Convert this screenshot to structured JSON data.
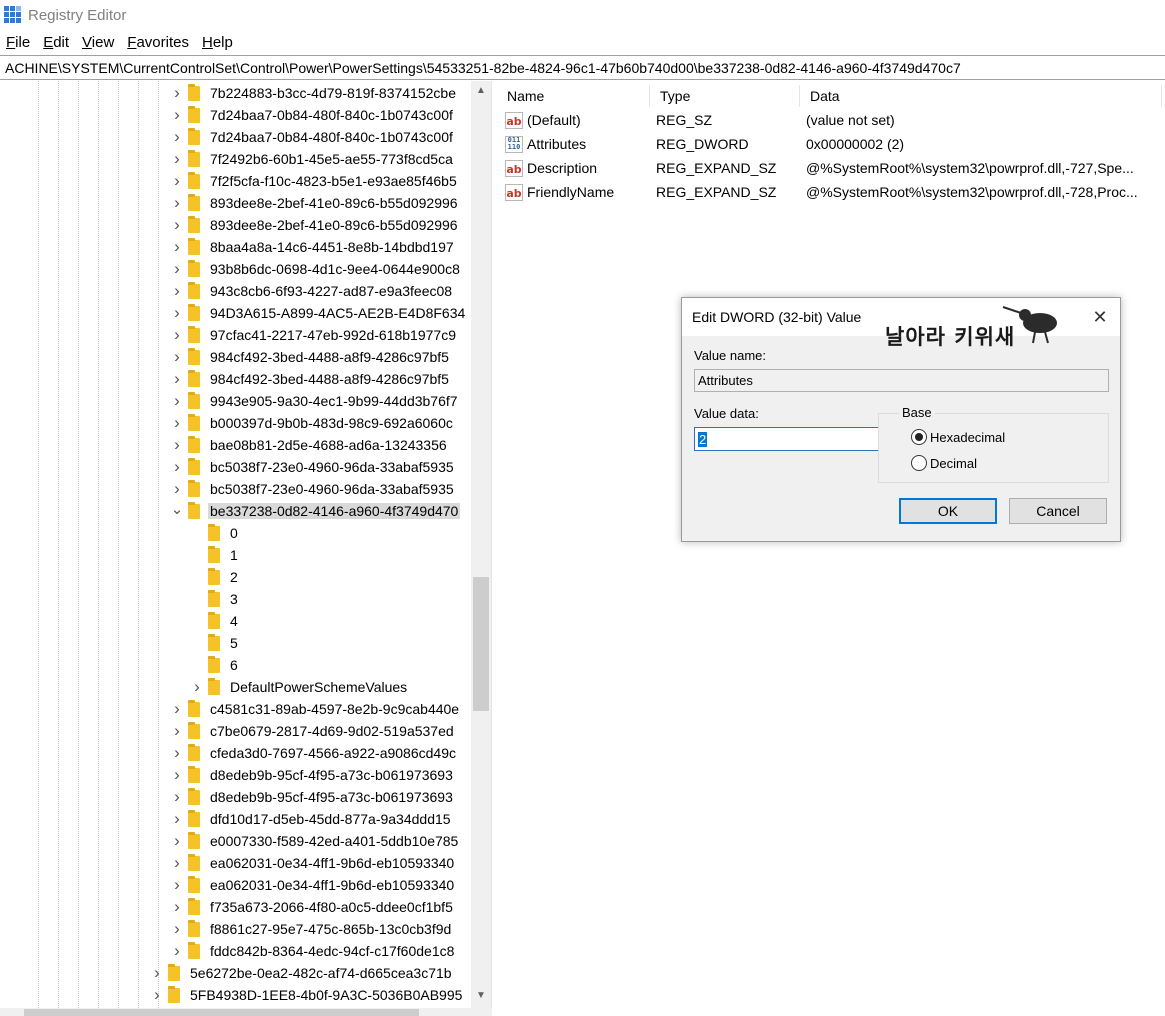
{
  "window": {
    "title": "Registry Editor",
    "icon": "registry-editor-icon"
  },
  "menu": [
    {
      "first": "F",
      "rest": "ile"
    },
    {
      "first": "E",
      "rest": "dit"
    },
    {
      "first": "V",
      "rest": "iew"
    },
    {
      "first": "F",
      "rest": "avorites"
    },
    {
      "first": "H",
      "rest": "elp"
    }
  ],
  "address": "ACHINE\\SYSTEM\\CurrentControlSet\\Control\\Power\\PowerSettings\\54533251-82be-4824-96c1-47b60b740d00\\be337238-0d82-4146-a960-4f3749d470c7",
  "tree": [
    {
      "label": "7b224883-b3cc-4d79-819f-8374152cbe",
      "level": 1,
      "expander": "collapsed"
    },
    {
      "label": "7d24baa7-0b84-480f-840c-1b0743c00f",
      "level": 1,
      "expander": "collapsed"
    },
    {
      "label": "7d24baa7-0b84-480f-840c-1b0743c00f",
      "level": 1,
      "expander": "collapsed"
    },
    {
      "label": "7f2492b6-60b1-45e5-ae55-773f8cd5ca",
      "level": 1,
      "expander": "collapsed"
    },
    {
      "label": "7f2f5cfa-f10c-4823-b5e1-e93ae85f46b5",
      "level": 1,
      "expander": "collapsed"
    },
    {
      "label": "893dee8e-2bef-41e0-89c6-b55d092996",
      "level": 1,
      "expander": "collapsed"
    },
    {
      "label": "893dee8e-2bef-41e0-89c6-b55d092996",
      "level": 1,
      "expander": "collapsed"
    },
    {
      "label": "8baa4a8a-14c6-4451-8e8b-14bdbd197",
      "level": 1,
      "expander": "collapsed"
    },
    {
      "label": "93b8b6dc-0698-4d1c-9ee4-0644e900c8",
      "level": 1,
      "expander": "collapsed"
    },
    {
      "label": "943c8cb6-6f93-4227-ad87-e9a3feec08",
      "level": 1,
      "expander": "collapsed"
    },
    {
      "label": "94D3A615-A899-4AC5-AE2B-E4D8F634",
      "level": 1,
      "expander": "collapsed"
    },
    {
      "label": "97cfac41-2217-47eb-992d-618b1977c9",
      "level": 1,
      "expander": "collapsed"
    },
    {
      "label": "984cf492-3bed-4488-a8f9-4286c97bf5",
      "level": 1,
      "expander": "collapsed"
    },
    {
      "label": "984cf492-3bed-4488-a8f9-4286c97bf5",
      "level": 1,
      "expander": "collapsed"
    },
    {
      "label": "9943e905-9a30-4ec1-9b99-44dd3b76f7",
      "level": 1,
      "expander": "collapsed"
    },
    {
      "label": "b000397d-9b0b-483d-98c9-692a6060c",
      "level": 1,
      "expander": "collapsed"
    },
    {
      "label": "bae08b81-2d5e-4688-ad6a-13243356",
      "level": 1,
      "expander": "collapsed"
    },
    {
      "label": "bc5038f7-23e0-4960-96da-33abaf5935",
      "level": 1,
      "expander": "collapsed"
    },
    {
      "label": "bc5038f7-23e0-4960-96da-33abaf5935",
      "level": 1,
      "expander": "collapsed"
    },
    {
      "label": "be337238-0d82-4146-a960-4f3749d470",
      "level": 1,
      "expander": "expanded",
      "selected": true
    },
    {
      "label": "0",
      "level": 2,
      "expander": "none"
    },
    {
      "label": "1",
      "level": 2,
      "expander": "none"
    },
    {
      "label": "2",
      "level": 2,
      "expander": "none"
    },
    {
      "label": "3",
      "level": 2,
      "expander": "none"
    },
    {
      "label": "4",
      "level": 2,
      "expander": "none"
    },
    {
      "label": "5",
      "level": 2,
      "expander": "none"
    },
    {
      "label": "6",
      "level": 2,
      "expander": "none"
    },
    {
      "label": "DefaultPowerSchemeValues",
      "level": 2,
      "expander": "collapsed"
    },
    {
      "label": "c4581c31-89ab-4597-8e2b-9c9cab440e",
      "level": 1,
      "expander": "collapsed"
    },
    {
      "label": "c7be0679-2817-4d69-9d02-519a537ed",
      "level": 1,
      "expander": "collapsed"
    },
    {
      "label": "cfeda3d0-7697-4566-a922-a9086cd49c",
      "level": 1,
      "expander": "collapsed"
    },
    {
      "label": "d8edeb9b-95cf-4f95-a73c-b061973693",
      "level": 1,
      "expander": "collapsed"
    },
    {
      "label": "d8edeb9b-95cf-4f95-a73c-b061973693",
      "level": 1,
      "expander": "collapsed"
    },
    {
      "label": "dfd10d17-d5eb-45dd-877a-9a34ddd15",
      "level": 1,
      "expander": "collapsed"
    },
    {
      "label": "e0007330-f589-42ed-a401-5ddb10e785",
      "level": 1,
      "expander": "collapsed"
    },
    {
      "label": "ea062031-0e34-4ff1-9b6d-eb10593340",
      "level": 1,
      "expander": "collapsed"
    },
    {
      "label": "ea062031-0e34-4ff1-9b6d-eb10593340",
      "level": 1,
      "expander": "collapsed"
    },
    {
      "label": "f735a673-2066-4f80-a0c5-ddee0cf1bf5",
      "level": 1,
      "expander": "collapsed"
    },
    {
      "label": "f8861c27-95e7-475c-865b-13c0cb3f9d",
      "level": 1,
      "expander": "collapsed"
    },
    {
      "label": "fddc842b-8364-4edc-94cf-c17f60de1c8",
      "level": 1,
      "expander": "collapsed"
    },
    {
      "label": "5e6272be-0ea2-482c-af74-d665cea3c71b",
      "level": 0,
      "expander": "collapsed"
    },
    {
      "label": "5FB4938D-1EE8-4b0f-9A3C-5036B0AB995",
      "level": 0,
      "expander": "collapsed"
    }
  ],
  "values_pane": {
    "headers": {
      "name": "Name",
      "type": "Type",
      "data": "Data"
    },
    "rows": [
      {
        "icon": "string-value-icon",
        "name": "(Default)",
        "type": "REG_SZ",
        "data": "(value not set)"
      },
      {
        "icon": "binary-value-icon",
        "name": "Attributes",
        "type": "REG_DWORD",
        "data": "0x00000002 (2)"
      },
      {
        "icon": "string-value-icon",
        "name": "Description",
        "type": "REG_EXPAND_SZ",
        "data": "@%SystemRoot%\\system32\\powrprof.dll,-727,Spe..."
      },
      {
        "icon": "string-value-icon",
        "name": "FriendlyName",
        "type": "REG_EXPAND_SZ",
        "data": "@%SystemRoot%\\system32\\powrprof.dll,-728,Proc..."
      }
    ]
  },
  "dialog": {
    "title": "Edit DWORD (32-bit) Value",
    "watermark_text": "날아라 키위새",
    "value_name_label": "Value name:",
    "value_name": "Attributes",
    "value_data_label": "Value data:",
    "value_data": "2",
    "base_label": "Base",
    "base_options": [
      {
        "label": "Hexadecimal",
        "checked": true
      },
      {
        "label": "Decimal",
        "checked": false
      }
    ],
    "ok_label": "OK",
    "cancel_label": "Cancel"
  }
}
